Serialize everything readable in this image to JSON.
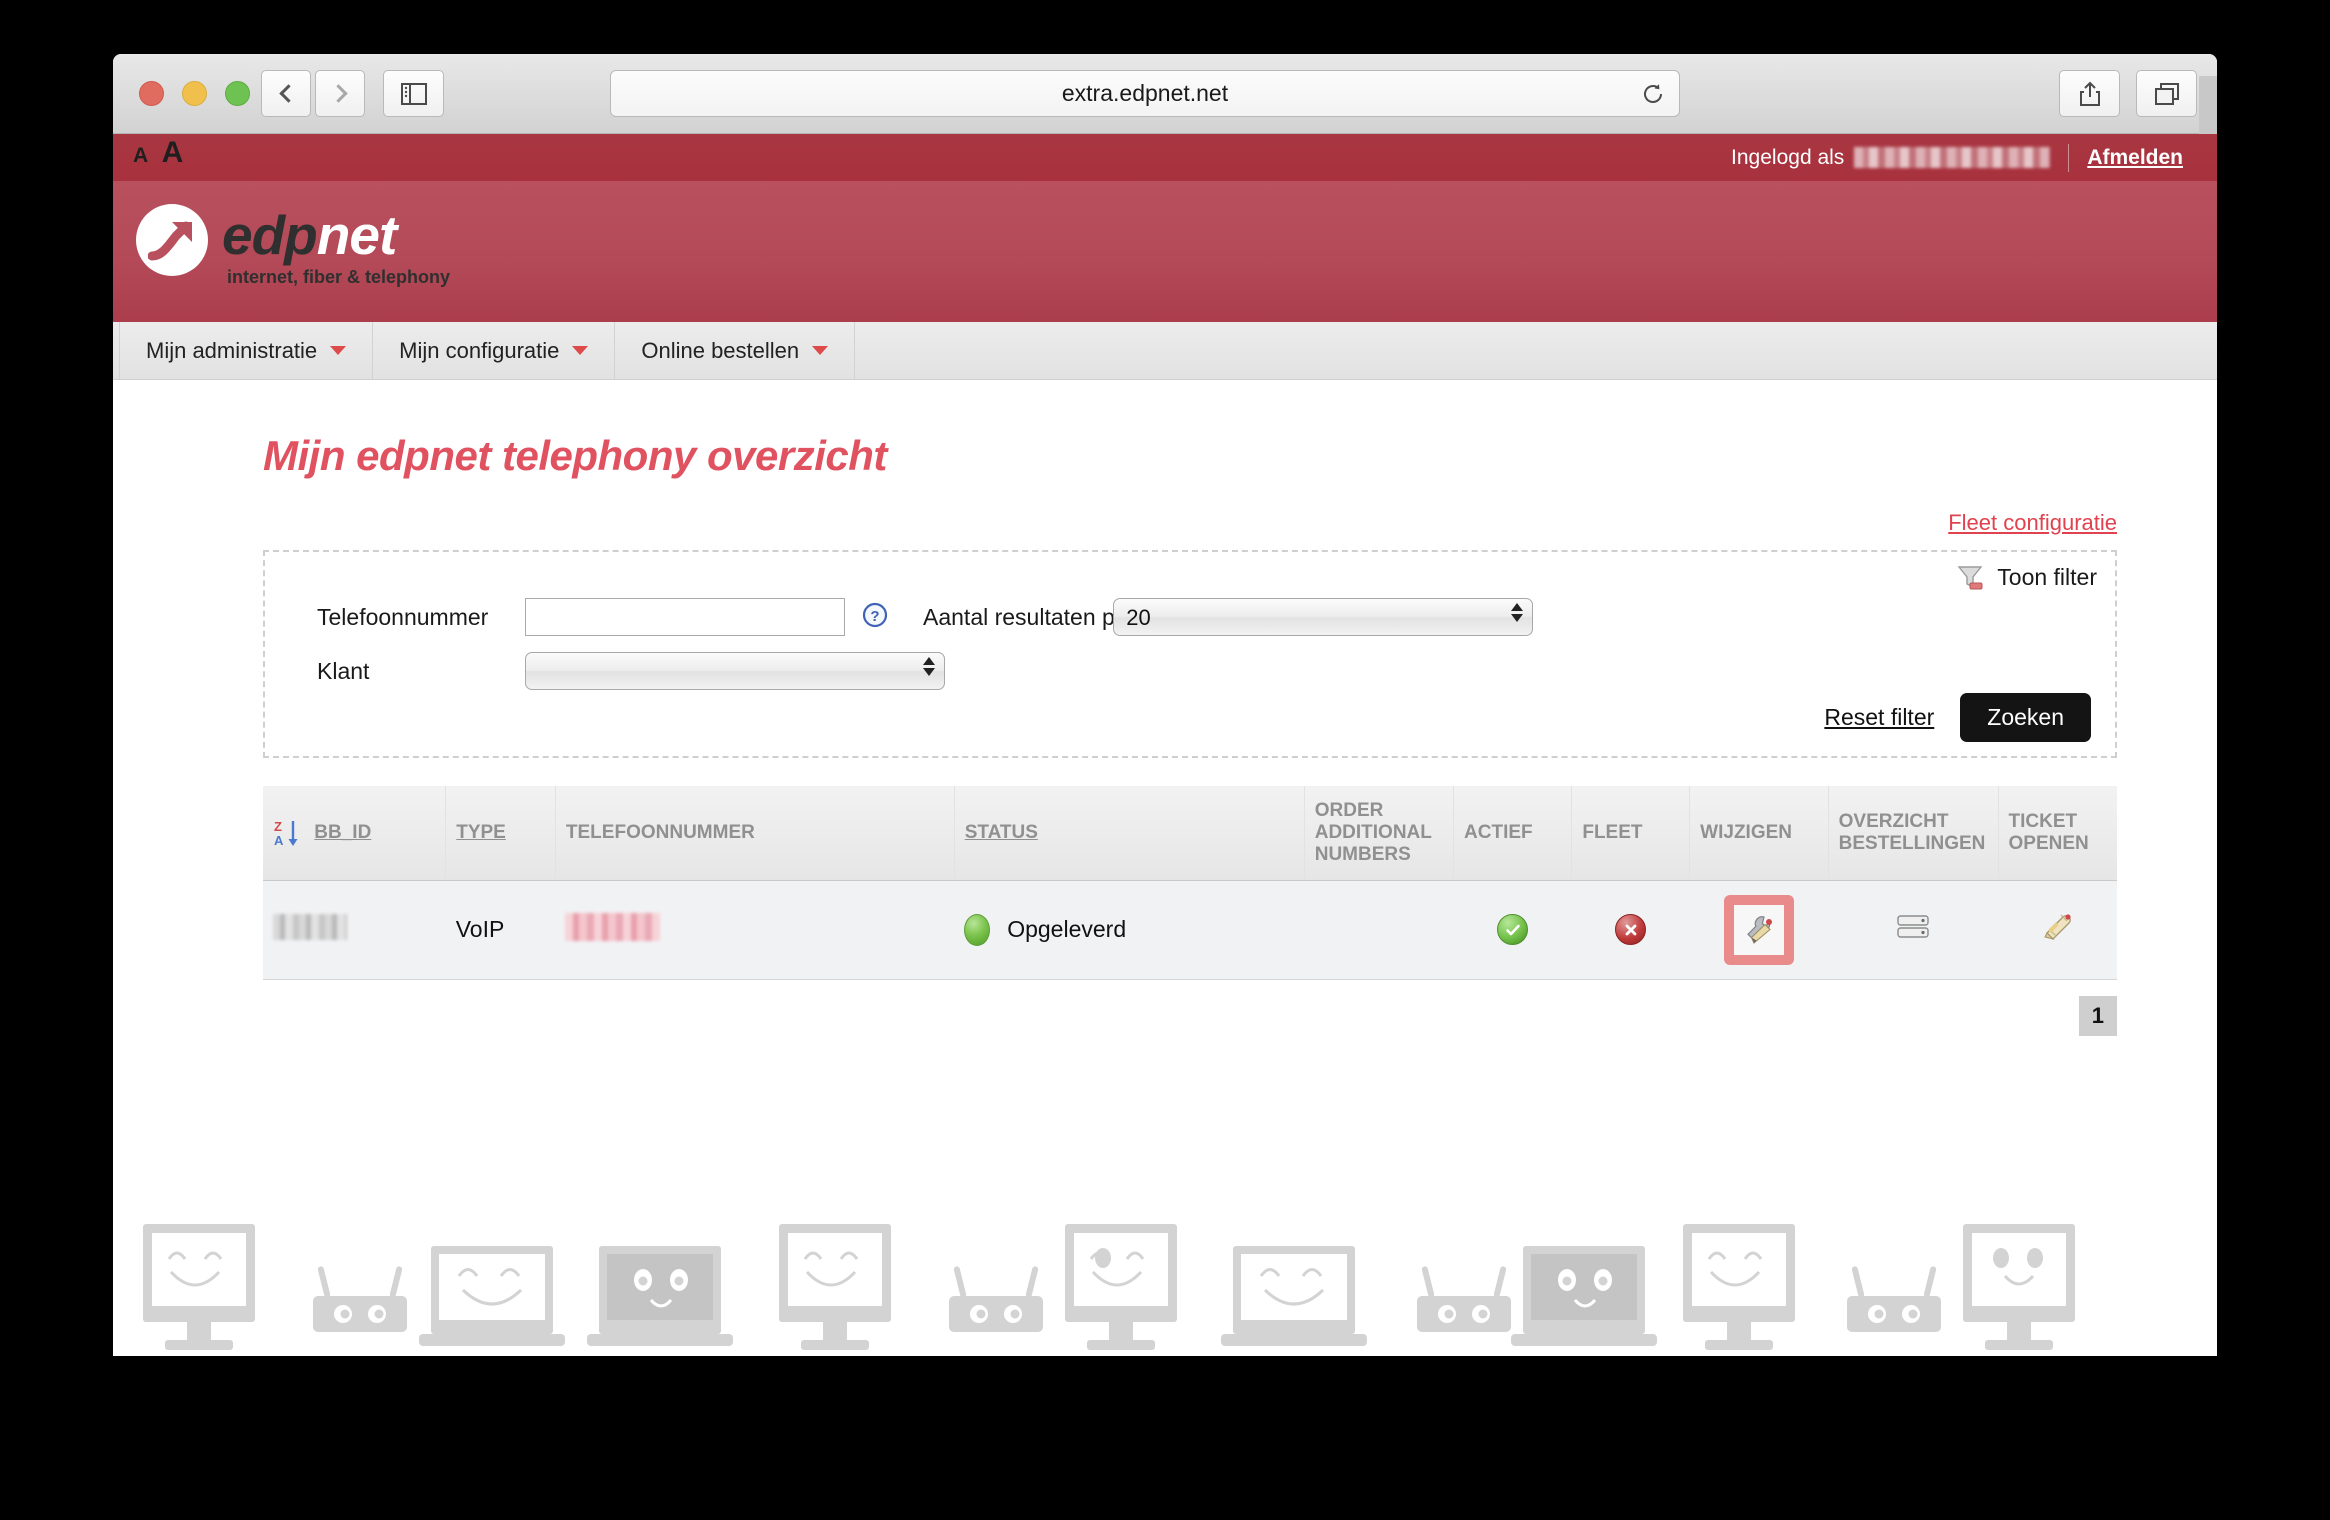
{
  "browser": {
    "url": "extra.edpnet.net",
    "back_icon": "chevron-left-icon",
    "forward_icon": "chevron-right-icon",
    "sidebar_icon": "sidebar-icon",
    "reload_icon": "reload-icon",
    "share_icon": "share-icon",
    "tabs_icon": "tabs-icon",
    "newtab_label": "+"
  },
  "topbar": {
    "font_small": "A",
    "font_large": "A",
    "logged_in_label": "Ingelogd als",
    "username": "",
    "logout_label": "Afmelden"
  },
  "brand": {
    "word_first": "edp",
    "word_second": "net",
    "tagline": "internet, fiber & telephony"
  },
  "menu": {
    "items": [
      {
        "label": "Mijn administratie"
      },
      {
        "label": "Mijn configuratie"
      },
      {
        "label": "Online bestellen"
      }
    ]
  },
  "main": {
    "page_title": "Mijn edpnet telephony overzicht",
    "fleet_link": "Fleet configuratie"
  },
  "filter": {
    "toon_filter_label": "Toon filter",
    "telefoonnummer_label": "Telefoonnummer",
    "telefoonnummer_value": "",
    "telefoonnummer_placeholder": "",
    "help_icon": "question-mark-icon",
    "klant_label": "Klant",
    "klant_value": "",
    "aantal_label": "Aantal resultaten per",
    "aantal_value": "20",
    "reset_label": "Reset filter",
    "zoeken_label": "Zoeken"
  },
  "table": {
    "headers": [
      {
        "label": "BB_ID",
        "sortable": true,
        "sorted": true
      },
      {
        "label": "TYPE",
        "sortable": true,
        "sorted": false
      },
      {
        "label": "TELEFOONNUMMER",
        "sortable": false,
        "sorted": false
      },
      {
        "label": "STATUS",
        "sortable": true,
        "sorted": false
      },
      {
        "label": "ORDER ADDITIONAL NUMBERS",
        "sortable": false,
        "sorted": false
      },
      {
        "label": "ACTIEF",
        "sortable": false,
        "sorted": false
      },
      {
        "label": "FLEET",
        "sortable": false,
        "sorted": false
      },
      {
        "label": "WIJZIGEN",
        "sortable": false,
        "sorted": false
      },
      {
        "label": "OVERZICHT BESTELLINGEN",
        "sortable": false,
        "sorted": false
      },
      {
        "label": "TICKET OPENEN",
        "sortable": false,
        "sorted": false
      }
    ],
    "rows": [
      {
        "bb_id": "",
        "type": "VoIP",
        "telefoonnummer": "",
        "status": "Opgeleverd",
        "status_indicator": "green-orb-icon",
        "order_additional_numbers": "",
        "actief": "green-check-icon",
        "fleet": "red-cross-icon",
        "wijzigen": "wrench-pencil-icon",
        "overzicht_bestellingen": "server-list-icon",
        "ticket_openen": "ticket-pencil-icon"
      }
    ]
  },
  "pagination": {
    "current_page": "1"
  },
  "colors": {
    "brand_red": "#b8505e",
    "topbar_red": "#a8313d",
    "title_red": "#e05260",
    "link_red": "#e0434f",
    "highlight": "#e98b8b",
    "status_green": "#72bf48",
    "status_red": "#c03a3a"
  }
}
